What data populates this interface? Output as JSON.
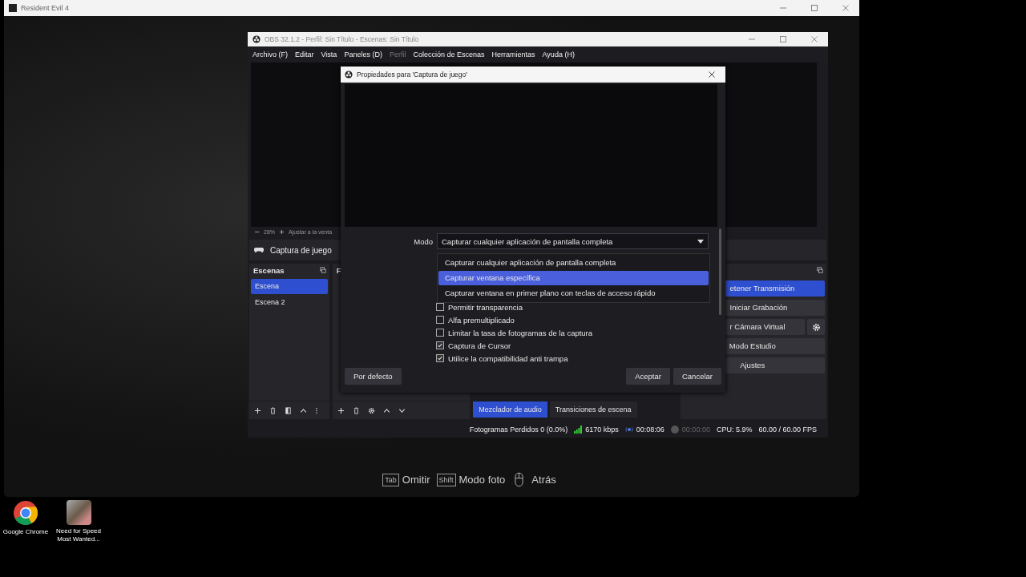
{
  "game_window": {
    "title": "Resident Evil 4",
    "hints": [
      {
        "kind": "key",
        "key": "Tab",
        "label": "Omitir"
      },
      {
        "kind": "key",
        "key": "Shift",
        "label": "Modo foto"
      },
      {
        "kind": "mouse",
        "label": "Atrás"
      }
    ]
  },
  "desktop_icons": [
    {
      "kind": "chrome",
      "label": "Google Chrome"
    },
    {
      "kind": "game",
      "label": "Need for Speed Most Wanted..."
    }
  ],
  "obs": {
    "title": "OBS 32.1.2 - Perfil: Sin Título - Escenas: Sin Título",
    "menu": [
      {
        "label": "Archivo (F)",
        "disabled": false
      },
      {
        "label": "Editar",
        "disabled": false
      },
      {
        "label": "Vista",
        "disabled": false
      },
      {
        "label": "Paneles (D)",
        "disabled": false
      },
      {
        "label": "Perfil",
        "disabled": true
      },
      {
        "label": "Colección de Escenas",
        "disabled": false
      },
      {
        "label": "Herramientas",
        "disabled": false
      },
      {
        "label": "Ayuda (H)",
        "disabled": false
      }
    ],
    "zoom_bar": {
      "zoom": "28%",
      "fit": "Ajustar a la venta"
    },
    "source_bar": {
      "name": "Captura de juego"
    },
    "scenes": {
      "title": "Escenas",
      "items": [
        {
          "label": "Escena",
          "selected": true
        },
        {
          "label": "Escena 2",
          "selected": false
        }
      ]
    },
    "sources": {
      "title": "F"
    },
    "mixer_tabs": [
      {
        "label": "Mezclador de audio",
        "selected": true
      },
      {
        "label": "Transiciones de escena",
        "selected": false
      }
    ],
    "controls": [
      {
        "kind": "cut",
        "label": "etener Transmisión",
        "on": true
      },
      {
        "kind": "cut",
        "label": "Iniciar Grabación",
        "on": false
      },
      {
        "kind": "cut_gear",
        "label": "r Cámara Virtual",
        "on": false
      },
      {
        "kind": "full",
        "label": "Modo Estudio",
        "on": false
      },
      {
        "kind": "full",
        "label": "Ajustes",
        "on": false
      }
    ],
    "status": {
      "dropped": "Fotogramas Perdidos 0 (0.0%)",
      "bitrate": "6170 kbps",
      "stream_time": "00:08:06",
      "record_time": "00:00:00",
      "cpu": "CPU: 5.9%",
      "fps": "60.00 / 60.00 FPS"
    }
  },
  "dialog": {
    "title": "Propiedades para 'Captura de juego'",
    "mode_label": "Modo",
    "mode_value": "Capturar cualquier aplicación de pantalla completa",
    "options": [
      {
        "label": "Capturar cualquier aplicación de pantalla completa",
        "selected": false
      },
      {
        "label": "Capturar ventana específica",
        "selected": true
      },
      {
        "label": "Capturar ventana en primer plano con teclas de acceso rápido",
        "selected": false
      }
    ],
    "checkboxes": [
      {
        "label": "Permitir transparencia",
        "checked": false
      },
      {
        "label": "Alfa premultiplicado",
        "checked": false
      },
      {
        "label": "Limitar la tasa de fotogramas de la captura",
        "checked": false
      },
      {
        "label": "Captura de Cursor",
        "checked": true
      },
      {
        "label": "Utilice la compatibilidad anti trampa",
        "checked": true
      }
    ],
    "buttons": {
      "defaults": "Por defecto",
      "ok": "Aceptar",
      "cancel": "Cancelar"
    }
  }
}
